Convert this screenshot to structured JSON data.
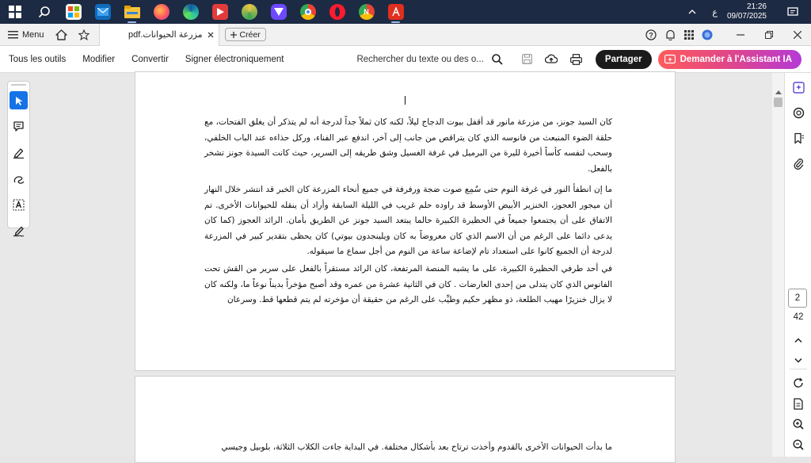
{
  "taskbar": {
    "app_icons": [
      "windows-start-icon",
      "search-icon",
      "microsoft-store-icon",
      "mail-icon",
      "file-explorer-icon",
      "firefox-icon",
      "edge-icon",
      "media-player-icon",
      "coin-app-icon",
      "proton-vpn-icon",
      "chrome-icon",
      "opera-icon",
      "chrome-profile-icon",
      "acrobat-icon"
    ],
    "tray": {
      "keyboard_lang": "ع",
      "time": "21:26",
      "date": "09/07/2025"
    }
  },
  "appbar": {
    "menu_label": "Menu",
    "tab_title": "مزرعة الحيوانات.pdf",
    "new_tab_label": "Créer"
  },
  "toolbar": {
    "links": [
      "Tous les outils",
      "Modifier",
      "Convertir",
      "Signer électroniquement"
    ],
    "search_placeholder": "Rechercher du texte ou des o...",
    "share_label": "Partager",
    "assistant_label": "Demander à l'Assistant IA"
  },
  "document": {
    "page1_paragraphs": [
      "كان السيد جونز، من مزرعة مانور قد أقفل بيوت الدجاج ليلاً، لكنه كان ثملاً جداً لدرجة أنه لم يتذكر أن يغلق الفتحات، مع حلقة الضوء المنبعث من فانوسه الذي كان يتراقص من جانب إلى آخر، اندفع عبر الفناء، وركل حذاءه عند الباب الخلفي، وسحب لنفسه كأساً أخيرة لليرة من البرميل في غرفة الغسيل وشق طريقه إلى السرير، حيث كانت السيدة جونز تشخر بالفعل.",
      "ما إن انطفأ النور في غرفة النوم حتى سُمِع صوت ضجة ورفرفة في جميع أنحاء المزرعة كان الخبر قد انتشر خلال النهار أن ميجور العجوز، الخنزير الأبيض الأوسط قد راوده حلم غريب في الليلة السابقة وأراد أن ينقله للحيوانات الأخرى. تم الاتفاق على أن يجتمعوا جميعاً في الحظيرة الكبيرة حالما يبتعد السيد جونز عن الطريق بأمان. الرائد العجوز (كما كان يدعى دائما على الرغم من أن الاسم الذي كان معروضاً به كان ويلينجدون بيوتي) كان يحظى بتقدير كبير في المزرعة لدرجة أن الجميع كانوا على استعداد تام لإضاعة ساعة من النوم من أجل سماع ما سيقوله.",
      "في أحد طرفي الحظيرة الكبيرة، على ما يشبه المنصة المرتفعة، كان الرائد مستقراً بالفعل على سرير من القش تحت الفانوس الذي كان يتدلى من إحدى العارضات . كان في الثانية عشرة من عمره وقد أصبح مؤخراً بديناً نوعاً ما، ولكنه كان لا يزال خنزيرًا مهيب الطلعة، ذو مظهر حكيم وطيِّب على الرغم من حقيقة أن مؤخرته لم يتم قطعها قط. وسرعان"
    ],
    "page2_first_line": "ما بدأت الحيوانات الأخرى بالقدوم وأخذت ترتاح بعد بأشكال مختلفة. في البداية جاءت الكلاب الثلاثة، بلوبيل وجيسي"
  },
  "pager": {
    "current_page": "2",
    "total_pages": "42"
  },
  "colors": {
    "taskbar": "#1d2a43",
    "share_button": "#1b1b1b",
    "assistant_start": "#ff5b5b",
    "assistant_end": "#b53ad6",
    "accent": "#1473e6"
  }
}
